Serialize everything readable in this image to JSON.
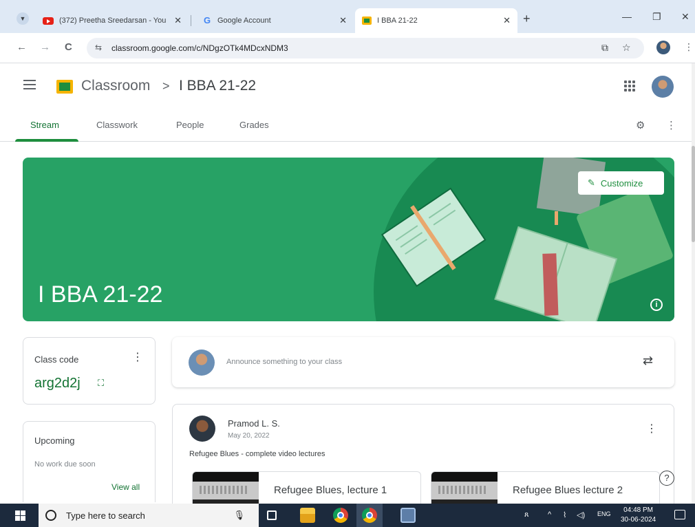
{
  "browser": {
    "tabs": [
      {
        "title": "(372) Preetha Sreedarsan - You",
        "close": "✕"
      },
      {
        "title": "Google Account",
        "close": "✕"
      },
      {
        "title": "I BBA 21-22",
        "close": "✕"
      }
    ],
    "new_tab": "+",
    "window_controls": {
      "minimize": "—",
      "maximize": "❐",
      "close": "✕"
    },
    "nav": {
      "back": "←",
      "forward": "→",
      "reload": "C"
    },
    "url": "classroom.google.com/c/NDgzOTk4MDcxNDM3"
  },
  "header": {
    "app_name": "Classroom",
    "separator": ">",
    "class_name": "I BBA 21-22"
  },
  "tabs": [
    "Stream",
    "Classwork",
    "People",
    "Grades"
  ],
  "banner": {
    "title": "I BBA 21-22",
    "customize_label": "Customize",
    "info": "i",
    "color": "#27a265"
  },
  "class_code": {
    "label": "Class code",
    "value": "arg2d2j"
  },
  "upcoming": {
    "title": "Upcoming",
    "empty_text": "No work due soon",
    "view_all": "View all"
  },
  "announce": {
    "placeholder": "Announce something to your class"
  },
  "post": {
    "author": "Pramod L. S.",
    "date": "May 20, 2022",
    "text": "Refugee Blues - complete video lectures",
    "attachments": [
      {
        "title": "Refugee Blues, lecture 1"
      },
      {
        "title": "Refugee Blues lecture 2"
      }
    ]
  },
  "help": "?",
  "taskbar": {
    "search_placeholder": "Type here to search",
    "tray_lang": "ENG",
    "time": "04:48 PM",
    "date": "30-06-2024"
  },
  "icons": [
    "chevron-down-icon",
    "youtube-icon",
    "google-icon",
    "classroom-icon",
    "back-icon",
    "forward-icon",
    "reload-icon",
    "site-settings-icon",
    "cast-icon",
    "star-icon",
    "hamburger-icon",
    "apps-icon",
    "gear-icon",
    "more-vert-icon",
    "pencil-icon",
    "info-icon",
    "expand-icon",
    "repost-icon",
    "help-icon",
    "windows-icon",
    "search-icon",
    "mic-icon",
    "task-view-icon",
    "file-explorer-icon",
    "chrome-icon",
    "notification-icon"
  ],
  "colors": {
    "accent": "#1e8e3e",
    "accent_text": "#137333",
    "taskbar": "#1c2a3d"
  }
}
